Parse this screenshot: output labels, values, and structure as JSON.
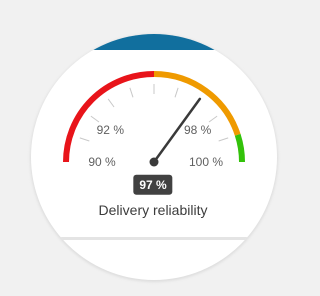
{
  "gauge": {
    "min": 90,
    "max": 100,
    "value": 97,
    "value_label": "97 %",
    "caption": "Delivery reliability",
    "colors": {
      "card_top_band": "#116f9e",
      "needle": "#3a3a3a",
      "minor_tick": "#c8c8c8",
      "band_low": "#e8141a",
      "band_mid": "#ef9a00",
      "band_high": "#33c20a"
    },
    "bands": [
      {
        "from": 90,
        "to": 95,
        "color": "#e8141a"
      },
      {
        "from": 95,
        "to": 99,
        "color": "#ef9a00"
      },
      {
        "from": 99,
        "to": 100,
        "color": "#33c20a"
      }
    ],
    "tick_labels": [
      {
        "value": 90,
        "text": "90 %"
      },
      {
        "value": 92,
        "text": "92 %"
      },
      {
        "value": 98,
        "text": "98 %"
      },
      {
        "value": 100,
        "text": "100 %"
      }
    ],
    "minor_ticks": [
      91,
      92,
      93,
      94,
      95,
      96,
      97,
      98,
      99
    ]
  }
}
